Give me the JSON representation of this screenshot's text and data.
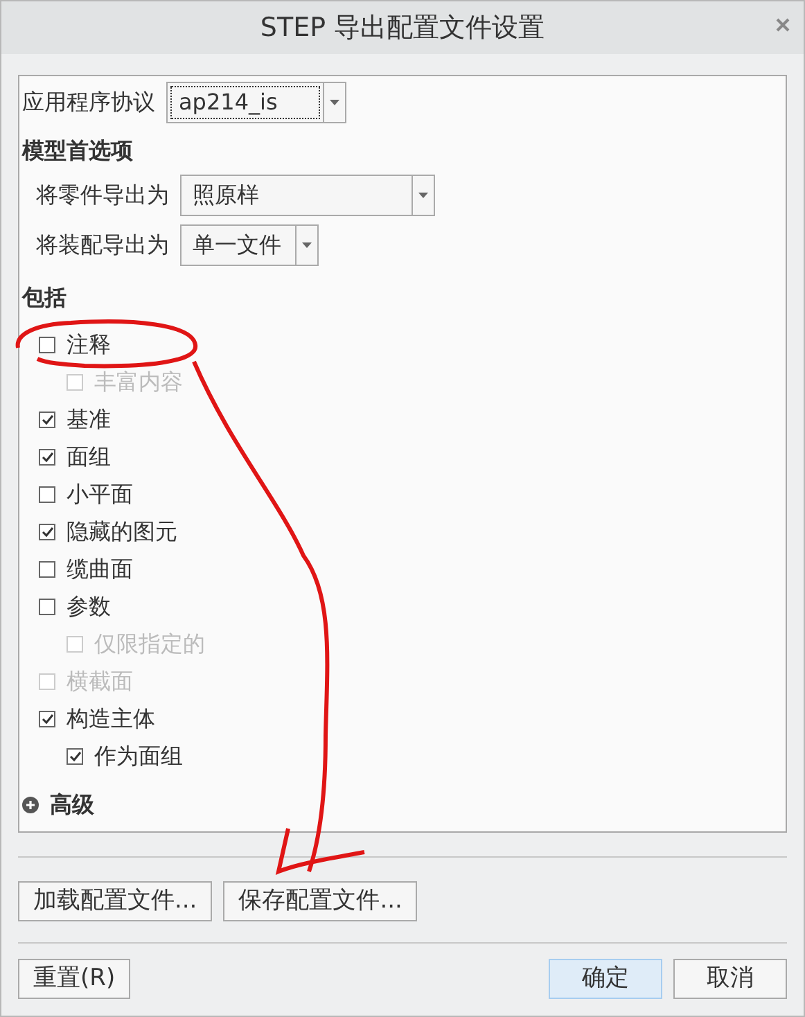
{
  "window": {
    "title": "STEP 导出配置文件设置"
  },
  "protocol": {
    "label": "应用程序协议",
    "value": "ap214_is"
  },
  "model_prefs": {
    "heading": "模型首选项",
    "fields": [
      {
        "label": "将零件导出为",
        "value": "照原样"
      },
      {
        "label": "将装配导出为",
        "value": "单一文件"
      }
    ]
  },
  "include": {
    "heading": "包括",
    "items": [
      {
        "label": "注释",
        "checked": false,
        "disabled": false,
        "children": [
          {
            "label": "丰富内容",
            "checked": false,
            "disabled": true
          }
        ]
      },
      {
        "label": "基准",
        "checked": true,
        "disabled": false
      },
      {
        "label": "面组",
        "checked": true,
        "disabled": false
      },
      {
        "label": "小平面",
        "checked": false,
        "disabled": false
      },
      {
        "label": "隐藏的图元",
        "checked": true,
        "disabled": false
      },
      {
        "label": "缆曲面",
        "checked": false,
        "disabled": false
      },
      {
        "label": "参数",
        "checked": false,
        "disabled": false,
        "children": [
          {
            "label": "仅限指定的",
            "checked": false,
            "disabled": true
          }
        ]
      },
      {
        "label": "横截面",
        "checked": false,
        "disabled": true
      },
      {
        "label": "构造主体",
        "checked": true,
        "disabled": false,
        "children": [
          {
            "label": "作为面组",
            "checked": true,
            "disabled": false
          }
        ]
      }
    ]
  },
  "advanced": {
    "label": "高级",
    "expanded": false
  },
  "file_buttons": [
    "加载配置文件...",
    "保存配置文件..."
  ],
  "footer": {
    "reset": "重置(R)",
    "buttons": [
      {
        "label": "确定",
        "default": true
      },
      {
        "label": "取消",
        "default": false
      }
    ]
  }
}
